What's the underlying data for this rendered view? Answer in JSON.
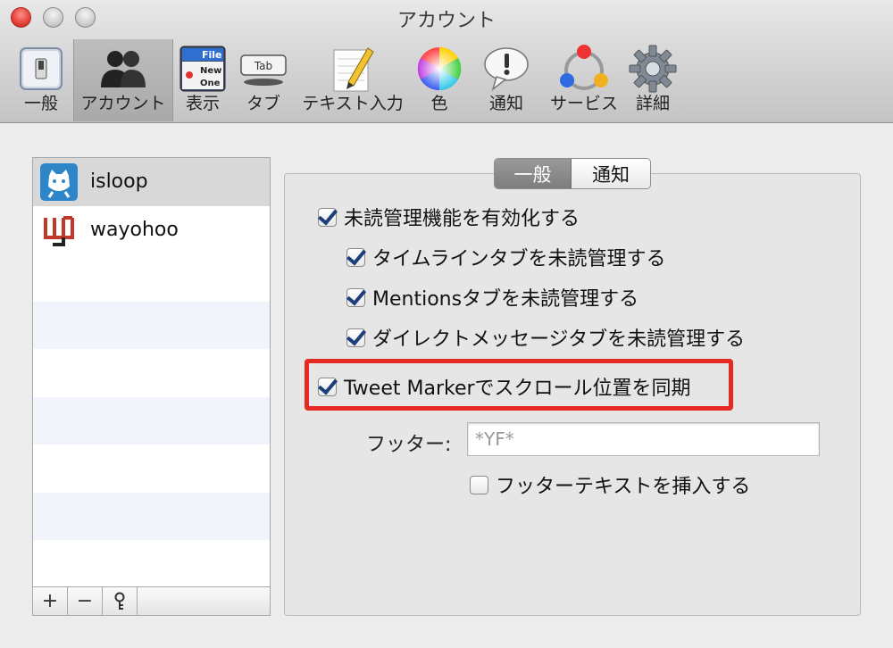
{
  "window": {
    "title": "アカウント"
  },
  "toolbar": {
    "items": [
      {
        "label": "一般",
        "icon": "switch-icon"
      },
      {
        "label": "アカウント",
        "icon": "users-icon"
      },
      {
        "label": "表示",
        "icon": "display-icon"
      },
      {
        "label": "タブ",
        "icon": "tab-icon"
      },
      {
        "label": "テキスト入力",
        "icon": "pencil-icon"
      },
      {
        "label": "色",
        "icon": "color-wheel-icon"
      },
      {
        "label": "通知",
        "icon": "notification-icon"
      },
      {
        "label": "サービス",
        "icon": "services-icon"
      },
      {
        "label": "詳細",
        "icon": "gear-icon"
      }
    ],
    "display_icon_text": {
      "line1": "File",
      "line2": "New",
      "line3": "One"
    },
    "tab_icon_text": "Tab"
  },
  "accounts": [
    {
      "name": "isloop",
      "avatar": "cat-avatar"
    },
    {
      "name": "wayohoo",
      "avatar": "wayohoo-logo"
    }
  ],
  "sidebar_buttons": {
    "add": "+",
    "remove": "−",
    "key": "key-icon"
  },
  "segments": {
    "general": "一般",
    "notification": "通知"
  },
  "options": {
    "enable_unread": "未読管理機能を有効化する",
    "timeline_unread": "タイムラインタブを未読管理する",
    "mentions_unread": "Mentionsタブを未読管理する",
    "dm_unread": "ダイレクトメッセージタブを未読管理する",
    "tweet_marker": "Tweet Markerでスクロール位置を同期",
    "insert_footer": "フッターテキストを挿入する"
  },
  "footer": {
    "label": "フッター:",
    "placeholder": "*YF*"
  },
  "colors": {
    "highlight": "#e52a23",
    "checkmark": "#1b3f7a",
    "selected_segment": "#8a8a8a"
  }
}
